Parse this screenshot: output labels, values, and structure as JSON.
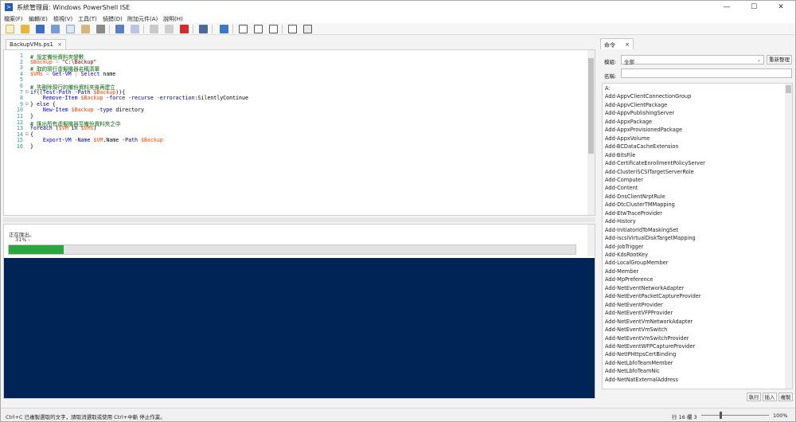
{
  "window": {
    "title": "系統管理員: Windows PowerShell ISE",
    "app_icon": "powershell-icon"
  },
  "menu": [
    "檔案(F)",
    "編輯(E)",
    "檢視(V)",
    "工具(T)",
    "偵錯(D)",
    "附加元件(A)",
    "說明(H)"
  ],
  "editor": {
    "tab_label": "BackupVMs.ps1",
    "lines": [
      {
        "n": "1",
        "t": [
          [
            "cm",
            "# 設定備份資料夾變數"
          ]
        ]
      },
      {
        "n": "2",
        "t": [
          [
            "vr",
            "$Backup"
          ],
          [
            "op",
            " = "
          ],
          [
            "st",
            "\"C:\\Backup\""
          ]
        ]
      },
      {
        "n": "3",
        "t": [
          [
            "cm",
            "# 取的現行虛擬機器名稱清單"
          ]
        ]
      },
      {
        "n": "4",
        "t": [
          [
            "vr",
            "$VMs"
          ],
          [
            "op",
            " = "
          ],
          [
            "cmd",
            "Get-VM"
          ],
          [
            "op",
            " | "
          ],
          [
            "cmd",
            "Select"
          ],
          [
            "mb",
            " name"
          ]
        ]
      },
      {
        "n": "5",
        "t": [
          [
            "mb",
            ""
          ]
        ]
      },
      {
        "n": "6",
        "t": [
          [
            "cm",
            "# 先刪除現行的備份資料夾後再建立"
          ]
        ]
      },
      {
        "n": "7",
        "t": [
          [
            "kw",
            "if"
          ],
          [
            "mb",
            "(("
          ],
          [
            "cmd",
            "Test-Path"
          ],
          [
            "prm",
            " -Path "
          ],
          [
            "vr",
            "$Backup"
          ],
          [
            "mb",
            "))"
          ],
          [
            "mb",
            "{"
          ]
        ]
      },
      {
        "n": "8",
        "t": [
          [
            "mb",
            "    "
          ],
          [
            "cmd",
            "Remove-Item"
          ],
          [
            "vr",
            " $Backup"
          ],
          [
            "prm",
            " -force -recurse -erroraction:"
          ],
          [
            "mb",
            "SilentlyContinue"
          ]
        ]
      },
      {
        "n": "9",
        "t": [
          [
            "mb",
            "} "
          ],
          [
            "kw",
            "else"
          ],
          [
            "mb",
            " {"
          ]
        ]
      },
      {
        "n": "10",
        "t": [
          [
            "mb",
            "    "
          ],
          [
            "cmd",
            "New-Item"
          ],
          [
            "vr",
            " $Backup"
          ],
          [
            "prm",
            " -type"
          ],
          [
            "mb",
            " directory"
          ]
        ]
      },
      {
        "n": "11",
        "t": [
          [
            "mb",
            "}"
          ]
        ]
      },
      {
        "n": "12",
        "t": [
          [
            "cm",
            "# 匯出所有虛擬機器至備份資料夾之中"
          ]
        ]
      },
      {
        "n": "13",
        "t": [
          [
            "kw",
            "foreach"
          ],
          [
            "mb",
            " ("
          ],
          [
            "vr",
            "$VM"
          ],
          [
            "kw",
            " in "
          ],
          [
            "vr",
            "$VMs"
          ],
          [
            "mb",
            ")"
          ]
        ]
      },
      {
        "n": "14",
        "t": [
          [
            "mb",
            "{"
          ]
        ]
      },
      {
        "n": "15",
        "t": [
          [
            "mb",
            "    "
          ],
          [
            "cmd",
            "Export-VM"
          ],
          [
            "prm",
            " -Name "
          ],
          [
            "vr",
            "$VM"
          ],
          [
            "mb",
            ".Name"
          ],
          [
            "prm",
            " -Path "
          ],
          [
            "vr",
            "$Backup"
          ]
        ]
      },
      {
        "n": "16",
        "t": [
          [
            "mb",
            "}"
          ]
        ]
      }
    ]
  },
  "progress": {
    "label": "正在匯出。",
    "percent_text": "31% -",
    "fraction": 0.31,
    "fill_color": "#2aa63f"
  },
  "console": {
    "background": "#012456"
  },
  "commands_pane": {
    "tab_label": "命令",
    "module_label": "模組:",
    "module_value": "全部",
    "refresh_label": "重新整理",
    "name_label": "名稱:",
    "name_value": "",
    "items": [
      "A:",
      "Add-AppvClientConnectionGroup",
      "Add-AppvClientPackage",
      "Add-AppvPublishingServer",
      "Add-AppxPackage",
      "Add-AppxProvisionedPackage",
      "Add-AppxVolume",
      "Add-BCDataCacheExtension",
      "Add-BitsFile",
      "Add-CertificateEnrollmentPolicyServer",
      "Add-ClusteriSCSITargetServerRole",
      "Add-Computer",
      "Add-Content",
      "Add-DnsClientNrptRule",
      "Add-DtcClusterTMMapping",
      "Add-EtwTraceProvider",
      "Add-History",
      "Add-InitiatorIdToMaskingSet",
      "Add-iscsiVirtualDiskTargetMapping",
      "Add-JobTrigger",
      "Add-KdsRootKey",
      "Add-LocalGroupMember",
      "Add-Member",
      "Add-MpPreference",
      "Add-NetEventNetworkAdapter",
      "Add-NetEventPacketCaptureProvider",
      "Add-NetEventProvider",
      "Add-NetEventVFPProvider",
      "Add-NetEventVmNetworkAdapter",
      "Add-NetEventVmSwitch",
      "Add-NetEventVmSwitchProvider",
      "Add-NetEventWFPCaptureProvider",
      "Add-NetIPHttpsCertBinding",
      "Add-NetLbfoTeamMember",
      "Add-NetLbfoTeamNic",
      "Add-NetNatExternalAddress"
    ],
    "run_label": "執行",
    "insert_label": "插入",
    "copy_label": "複製"
  },
  "status": {
    "message": "Ctrl+C 已複製選取的文字，請取消選取或使用 Ctrl+中斷 停止作業。",
    "position": "行 16 欄 3",
    "zoom": "100%",
    "zoom_fraction": 0.25
  }
}
